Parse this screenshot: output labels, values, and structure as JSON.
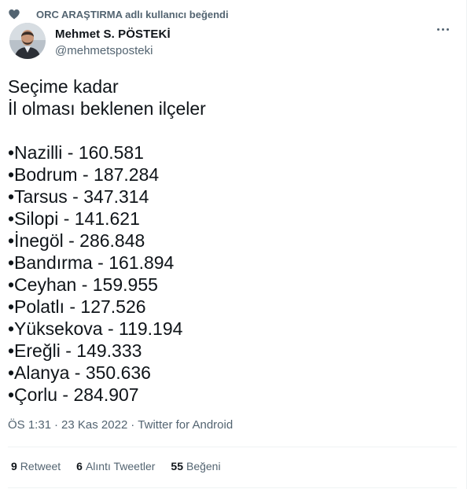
{
  "social_context": "ORC ARAŞTIRMA adlı kullanıcı beğendi",
  "author": {
    "name": "Mehmet S. PÖSTEKİ",
    "handle": "@mehmetsposteki"
  },
  "tweet": {
    "text": "Seçime kadar\nİl olması beklenen ilçeler\n\n•Nazilli - 160.581\n•Bodrum - 187.284\n•Tarsus - 347.314\n•Silopi - 141.621\n•İnegöl - 286.848\n•Bandırma - 161.894\n•Ceyhan - 159.955\n•Polatlı - 127.526\n•Yüksekova - 119.194\n•Ereğli - 149.333\n•Alanya - 350.636\n•Çorlu - 284.907"
  },
  "meta": {
    "time": "ÖS 1:31",
    "date": "23 Kas 2022",
    "source": "Twitter for Android",
    "separator": "·"
  },
  "stats": {
    "retweets": {
      "count": "9",
      "label": "Retweet"
    },
    "quotes": {
      "count": "6",
      "label": "Alıntı Tweetler"
    },
    "likes": {
      "count": "55",
      "label": "Beğeni"
    }
  },
  "icons": {
    "social": "heart-icon",
    "more": "more-options-icon"
  }
}
